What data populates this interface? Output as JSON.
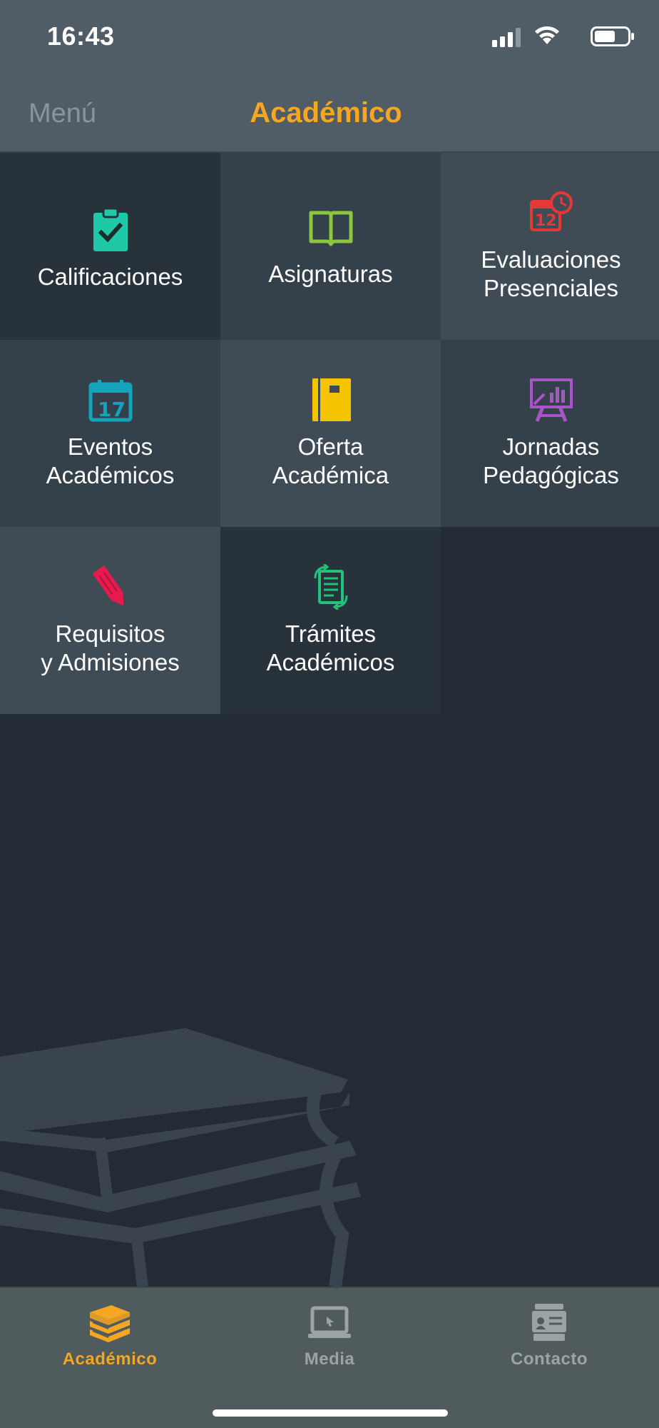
{
  "status_bar": {
    "time": "16:43"
  },
  "nav": {
    "back_label": "Menú",
    "title": "Académico"
  },
  "colors": {
    "accent": "#f5a623",
    "nav_bg": "#505c66",
    "page_bg": "#232c35",
    "tab_inactive": "#9aa3a5"
  },
  "tiles": [
    {
      "label": "Calificaciones",
      "icon": "clipboard-check-icon",
      "color": "#1fc8a7"
    },
    {
      "label": "Asignaturas",
      "icon": "open-book-icon",
      "color": "#8cc63f"
    },
    {
      "label": "Evaluaciones\nPresenciales",
      "icon": "calendar-clock-icon",
      "color": "#e53935"
    },
    {
      "label": "Eventos\nAcadémicos",
      "icon": "calendar-17-icon",
      "color": "#14a3b8",
      "icon_text": "17"
    },
    {
      "label": "Oferta\nAcadémica",
      "icon": "notebook-icon",
      "color": "#f5c400"
    },
    {
      "label": "Jornadas\nPedagógicas",
      "icon": "presentation-board-icon",
      "color": "#a855c8"
    },
    {
      "label": "Requisitos\ny Admisiones",
      "icon": "pencil-icon",
      "color": "#e8194f"
    },
    {
      "label": "Trámites\nAcadémicos",
      "icon": "document-refresh-icon",
      "color": "#21c27a"
    }
  ],
  "tabs": [
    {
      "label": "Académico",
      "icon": "books-stack-icon",
      "active": true
    },
    {
      "label": "Media",
      "icon": "laptop-icon",
      "active": false
    },
    {
      "label": "Contacto",
      "icon": "contact-card-icon",
      "active": false
    }
  ]
}
